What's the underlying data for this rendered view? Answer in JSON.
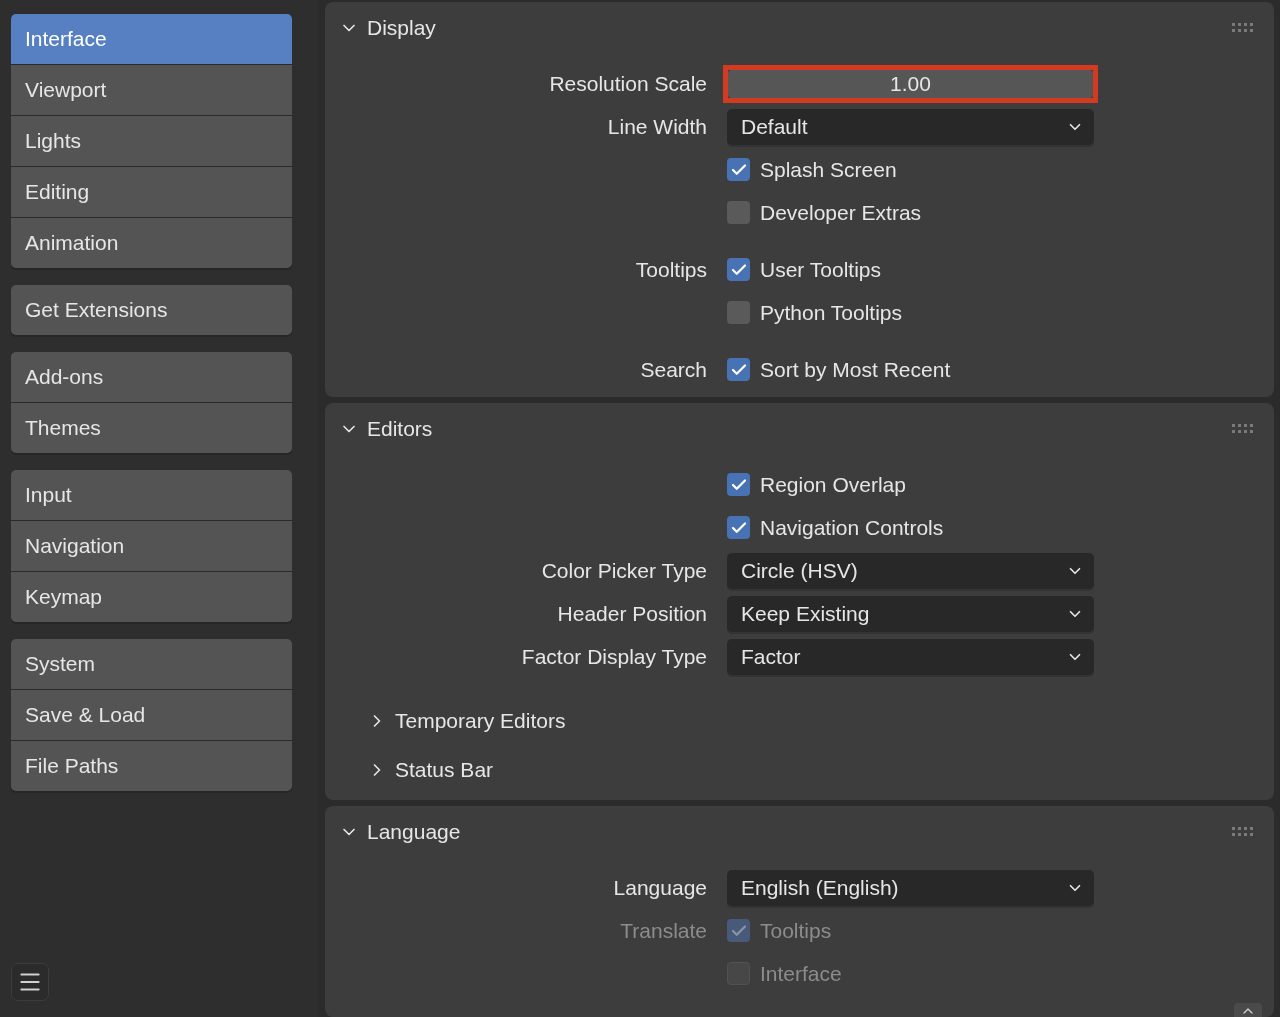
{
  "sidebar": {
    "groups": [
      [
        {
          "label": "Interface",
          "selected": true
        },
        {
          "label": "Viewport",
          "selected": false
        },
        {
          "label": "Lights",
          "selected": false
        },
        {
          "label": "Editing",
          "selected": false
        },
        {
          "label": "Animation",
          "selected": false
        }
      ],
      [
        {
          "label": "Get Extensions",
          "selected": false
        }
      ],
      [
        {
          "label": "Add-ons",
          "selected": false
        },
        {
          "label": "Themes",
          "selected": false
        }
      ],
      [
        {
          "label": "Input",
          "selected": false
        },
        {
          "label": "Navigation",
          "selected": false
        },
        {
          "label": "Keymap",
          "selected": false
        }
      ],
      [
        {
          "label": "System",
          "selected": false
        },
        {
          "label": "Save & Load",
          "selected": false
        },
        {
          "label": "File Paths",
          "selected": false
        }
      ]
    ]
  },
  "panels": [
    {
      "title": "Display",
      "expanded": true,
      "groups": [
        [
          {
            "kind": "number",
            "label": "Resolution Scale",
            "value": "1.00",
            "highlighted": true
          },
          {
            "kind": "dropdown",
            "label": "Line Width",
            "value": "Default"
          },
          {
            "kind": "checkbox",
            "text": "Splash Screen",
            "checked": true
          },
          {
            "kind": "checkbox",
            "text": "Developer Extras",
            "checked": false
          }
        ],
        [
          {
            "kind": "checkbox",
            "label": "Tooltips",
            "text": "User Tooltips",
            "checked": true
          },
          {
            "kind": "checkbox",
            "text": "Python Tooltips",
            "checked": false
          }
        ],
        [
          {
            "kind": "checkbox",
            "label": "Search",
            "text": "Sort by Most Recent",
            "checked": true
          }
        ]
      ]
    },
    {
      "title": "Editors",
      "expanded": true,
      "groups": [
        [
          {
            "kind": "checkbox",
            "text": "Region Overlap",
            "checked": true
          },
          {
            "kind": "checkbox",
            "text": "Navigation Controls",
            "checked": true
          },
          {
            "kind": "dropdown",
            "label": "Color Picker Type",
            "value": "Circle (HSV)"
          },
          {
            "kind": "dropdown",
            "label": "Header Position",
            "value": "Keep Existing"
          },
          {
            "kind": "dropdown",
            "label": "Factor Display Type",
            "value": "Factor"
          }
        ]
      ],
      "subpanels": [
        {
          "title": "Temporary Editors",
          "expanded": false
        },
        {
          "title": "Status Bar",
          "expanded": false
        }
      ]
    },
    {
      "title": "Language",
      "expanded": true,
      "groups": [
        [
          {
            "kind": "dropdown",
            "label": "Language",
            "value": "English (English)"
          },
          {
            "kind": "checkbox",
            "label": "Translate",
            "text": "Tooltips",
            "checked": true,
            "disabled": true
          },
          {
            "kind": "checkbox",
            "text": "Interface",
            "checked": false,
            "disabled": true
          }
        ]
      ]
    }
  ]
}
